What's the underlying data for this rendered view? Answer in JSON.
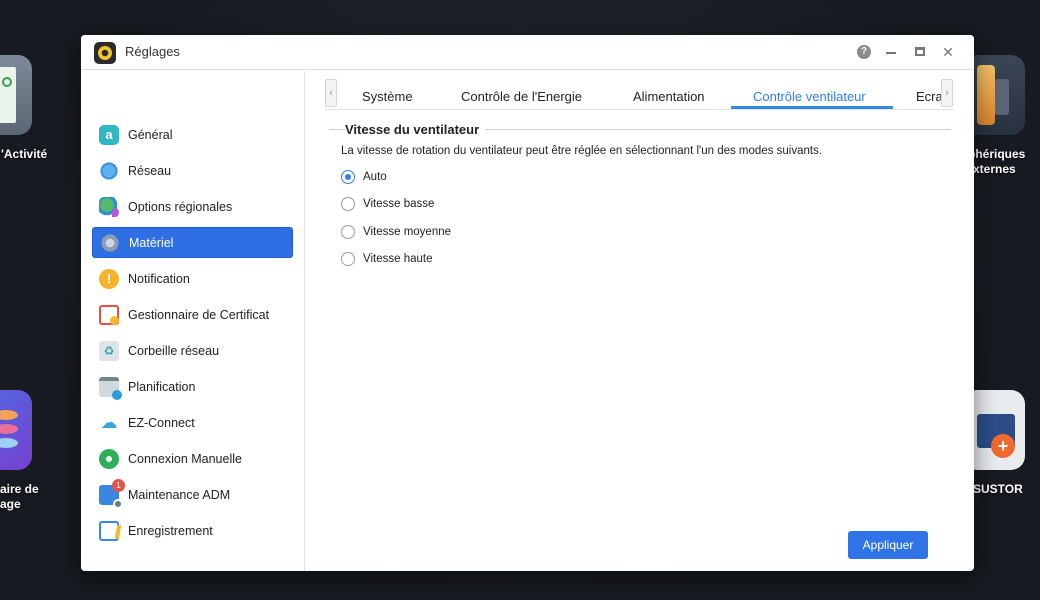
{
  "desktop": {
    "left_label_1": "'Activité",
    "left_label_2a": "aire de",
    "left_label_2b": "age",
    "right_label_1a": "phériques",
    "right_label_1b": "xternes",
    "right_label_2": "SUSTOR"
  },
  "window": {
    "title": "Réglages",
    "help_label": "?",
    "close_label": "✕"
  },
  "sidebar": {
    "items": [
      {
        "label": "Général",
        "icon": "general-icon"
      },
      {
        "label": "Réseau",
        "icon": "globe-icon"
      },
      {
        "label": "Options régionales",
        "icon": "region-icon"
      },
      {
        "label": "Matériel",
        "icon": "hardware-icon",
        "active": true
      },
      {
        "label": "Notification",
        "icon": "notification-icon"
      },
      {
        "label": "Gestionnaire de Certificat",
        "icon": "certificate-icon"
      },
      {
        "label": "Corbeille réseau",
        "icon": "recycle-bin-icon"
      },
      {
        "label": "Planification",
        "icon": "calendar-icon"
      },
      {
        "label": "EZ-Connect",
        "icon": "cloud-icon"
      },
      {
        "label": "Connexion Manuelle",
        "icon": "network-icon"
      },
      {
        "label": "Maintenance ADM",
        "icon": "maintenance-icon",
        "badge": "1"
      },
      {
        "label": "Enregistrement",
        "icon": "registration-icon"
      }
    ]
  },
  "tabs": {
    "prev_arrow": "‹",
    "next_arrow": "›",
    "items": [
      "Système",
      "Contrôle de l'Energie",
      "Alimentation",
      "Contrôle ventilateur",
      "Ecran"
    ],
    "active_index": 3
  },
  "fan": {
    "section_title": "Vitesse du ventilateur",
    "description": "La vitesse de rotation du ventilateur peut être réglée en sélectionnant l'un des modes suivants.",
    "options": [
      "Auto",
      "Vitesse basse",
      "Vitesse moyenne",
      "Vitesse haute"
    ],
    "selected_index": 0
  },
  "footer": {
    "apply_label": "Appliquer"
  },
  "colors": {
    "accent": "#2f73e6",
    "active_tab": "#2f7fe6",
    "badge": "#e5534b"
  }
}
